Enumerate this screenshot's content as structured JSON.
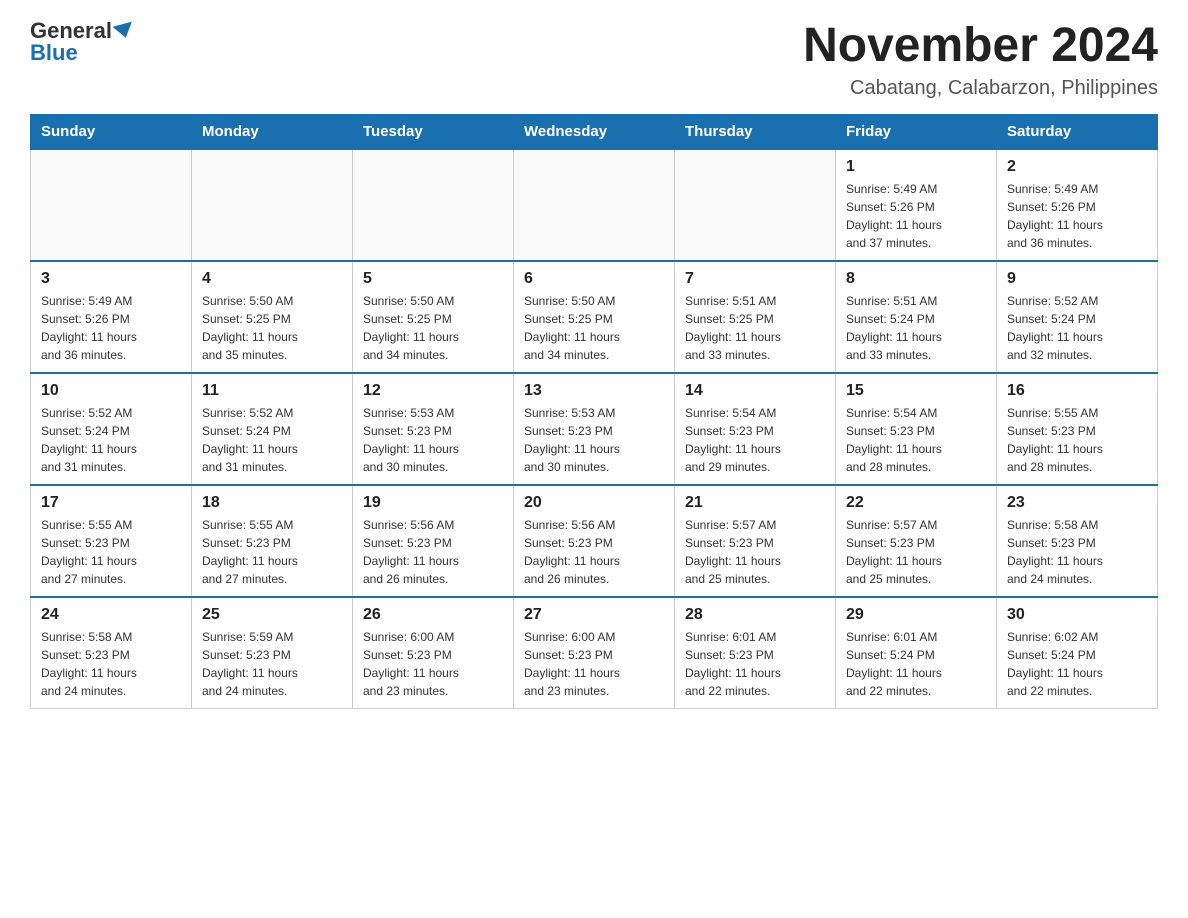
{
  "header": {
    "logo_general": "General",
    "logo_blue": "Blue",
    "month": "November 2024",
    "location": "Cabatang, Calabarzon, Philippines"
  },
  "weekdays": [
    "Sunday",
    "Monday",
    "Tuesday",
    "Wednesday",
    "Thursday",
    "Friday",
    "Saturday"
  ],
  "weeks": [
    [
      {
        "day": "",
        "info": ""
      },
      {
        "day": "",
        "info": ""
      },
      {
        "day": "",
        "info": ""
      },
      {
        "day": "",
        "info": ""
      },
      {
        "day": "",
        "info": ""
      },
      {
        "day": "1",
        "info": "Sunrise: 5:49 AM\nSunset: 5:26 PM\nDaylight: 11 hours\nand 37 minutes."
      },
      {
        "day": "2",
        "info": "Sunrise: 5:49 AM\nSunset: 5:26 PM\nDaylight: 11 hours\nand 36 minutes."
      }
    ],
    [
      {
        "day": "3",
        "info": "Sunrise: 5:49 AM\nSunset: 5:26 PM\nDaylight: 11 hours\nand 36 minutes."
      },
      {
        "day": "4",
        "info": "Sunrise: 5:50 AM\nSunset: 5:25 PM\nDaylight: 11 hours\nand 35 minutes."
      },
      {
        "day": "5",
        "info": "Sunrise: 5:50 AM\nSunset: 5:25 PM\nDaylight: 11 hours\nand 34 minutes."
      },
      {
        "day": "6",
        "info": "Sunrise: 5:50 AM\nSunset: 5:25 PM\nDaylight: 11 hours\nand 34 minutes."
      },
      {
        "day": "7",
        "info": "Sunrise: 5:51 AM\nSunset: 5:25 PM\nDaylight: 11 hours\nand 33 minutes."
      },
      {
        "day": "8",
        "info": "Sunrise: 5:51 AM\nSunset: 5:24 PM\nDaylight: 11 hours\nand 33 minutes."
      },
      {
        "day": "9",
        "info": "Sunrise: 5:52 AM\nSunset: 5:24 PM\nDaylight: 11 hours\nand 32 minutes."
      }
    ],
    [
      {
        "day": "10",
        "info": "Sunrise: 5:52 AM\nSunset: 5:24 PM\nDaylight: 11 hours\nand 31 minutes."
      },
      {
        "day": "11",
        "info": "Sunrise: 5:52 AM\nSunset: 5:24 PM\nDaylight: 11 hours\nand 31 minutes."
      },
      {
        "day": "12",
        "info": "Sunrise: 5:53 AM\nSunset: 5:23 PM\nDaylight: 11 hours\nand 30 minutes."
      },
      {
        "day": "13",
        "info": "Sunrise: 5:53 AM\nSunset: 5:23 PM\nDaylight: 11 hours\nand 30 minutes."
      },
      {
        "day": "14",
        "info": "Sunrise: 5:54 AM\nSunset: 5:23 PM\nDaylight: 11 hours\nand 29 minutes."
      },
      {
        "day": "15",
        "info": "Sunrise: 5:54 AM\nSunset: 5:23 PM\nDaylight: 11 hours\nand 28 minutes."
      },
      {
        "day": "16",
        "info": "Sunrise: 5:55 AM\nSunset: 5:23 PM\nDaylight: 11 hours\nand 28 minutes."
      }
    ],
    [
      {
        "day": "17",
        "info": "Sunrise: 5:55 AM\nSunset: 5:23 PM\nDaylight: 11 hours\nand 27 minutes."
      },
      {
        "day": "18",
        "info": "Sunrise: 5:55 AM\nSunset: 5:23 PM\nDaylight: 11 hours\nand 27 minutes."
      },
      {
        "day": "19",
        "info": "Sunrise: 5:56 AM\nSunset: 5:23 PM\nDaylight: 11 hours\nand 26 minutes."
      },
      {
        "day": "20",
        "info": "Sunrise: 5:56 AM\nSunset: 5:23 PM\nDaylight: 11 hours\nand 26 minutes."
      },
      {
        "day": "21",
        "info": "Sunrise: 5:57 AM\nSunset: 5:23 PM\nDaylight: 11 hours\nand 25 minutes."
      },
      {
        "day": "22",
        "info": "Sunrise: 5:57 AM\nSunset: 5:23 PM\nDaylight: 11 hours\nand 25 minutes."
      },
      {
        "day": "23",
        "info": "Sunrise: 5:58 AM\nSunset: 5:23 PM\nDaylight: 11 hours\nand 24 minutes."
      }
    ],
    [
      {
        "day": "24",
        "info": "Sunrise: 5:58 AM\nSunset: 5:23 PM\nDaylight: 11 hours\nand 24 minutes."
      },
      {
        "day": "25",
        "info": "Sunrise: 5:59 AM\nSunset: 5:23 PM\nDaylight: 11 hours\nand 24 minutes."
      },
      {
        "day": "26",
        "info": "Sunrise: 6:00 AM\nSunset: 5:23 PM\nDaylight: 11 hours\nand 23 minutes."
      },
      {
        "day": "27",
        "info": "Sunrise: 6:00 AM\nSunset: 5:23 PM\nDaylight: 11 hours\nand 23 minutes."
      },
      {
        "day": "28",
        "info": "Sunrise: 6:01 AM\nSunset: 5:23 PM\nDaylight: 11 hours\nand 22 minutes."
      },
      {
        "day": "29",
        "info": "Sunrise: 6:01 AM\nSunset: 5:24 PM\nDaylight: 11 hours\nand 22 minutes."
      },
      {
        "day": "30",
        "info": "Sunrise: 6:02 AM\nSunset: 5:24 PM\nDaylight: 11 hours\nand 22 minutes."
      }
    ]
  ]
}
